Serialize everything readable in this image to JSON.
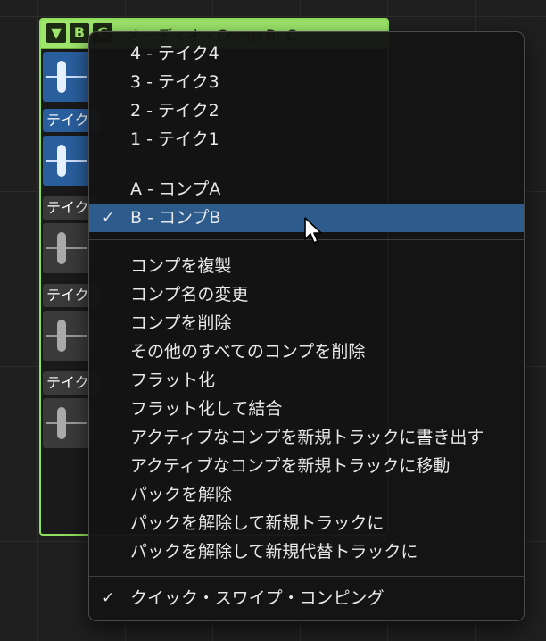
{
  "colors": {
    "folder_green": "#9de66b",
    "take_active": "#2a5f9e",
    "take_inactive": "#3a3a3a",
    "menu_bg": "#141414",
    "menu_selected": "#2d5b8c"
  },
  "take_folder": {
    "disclosure_icon": "triangle-down-icon",
    "btn_b": "B",
    "btn_c": "C",
    "title": "オーディオ・Comp B: C",
    "takes": [
      {
        "label": "",
        "state": "active"
      },
      {
        "label": "テイク",
        "state": "active"
      },
      {
        "label": "テイク",
        "state": "inactive"
      },
      {
        "label": "テイク",
        "state": "inactive"
      },
      {
        "label": "テイク",
        "state": "inactive"
      }
    ]
  },
  "menu": {
    "takes": [
      {
        "label": "4 - テイク4",
        "checked": false
      },
      {
        "label": "3 - テイク3",
        "checked": false
      },
      {
        "label": "2 - テイク2",
        "checked": false
      },
      {
        "label": "1 - テイク1",
        "checked": false
      }
    ],
    "comps": [
      {
        "label": "A - コンプA",
        "checked": false
      },
      {
        "label": "B - コンプB",
        "checked": true
      }
    ],
    "actions": [
      {
        "label": "コンプを複製"
      },
      {
        "label": "コンプ名の変更"
      },
      {
        "label": "コンプを削除"
      },
      {
        "label": "その他のすべてのコンプを削除"
      },
      {
        "label": "フラット化"
      },
      {
        "label": "フラット化して結合"
      },
      {
        "label": "アクティブなコンプを新規トラックに書き出す"
      },
      {
        "label": "アクティブなコンプを新規トラックに移動"
      },
      {
        "label": "パックを解除"
      },
      {
        "label": "パックを解除して新規トラックに"
      },
      {
        "label": "パックを解除して新規代替トラックに"
      }
    ],
    "options": [
      {
        "label": "クイック・スワイプ・コンピング",
        "checked": true
      }
    ],
    "check_glyph": "✓"
  }
}
